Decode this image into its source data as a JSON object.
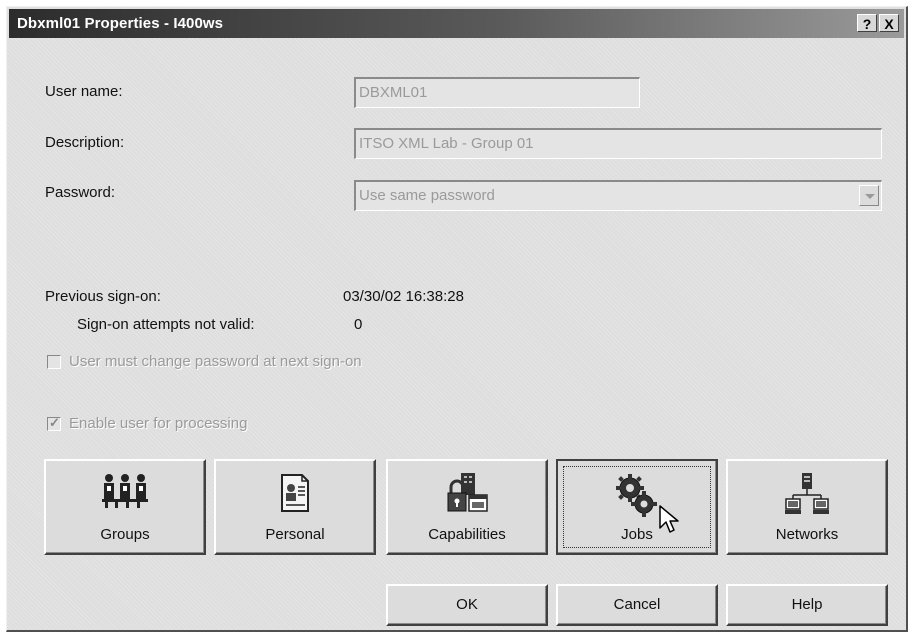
{
  "window": {
    "title": "Dbxml01 Properties - I400ws",
    "help_glyph": "?",
    "close_glyph": "X"
  },
  "form": {
    "user_name_label": "User name:",
    "user_name_value": "DBXML01",
    "description_label": "Description:",
    "description_value": "ITSO XML Lab - Group 01",
    "password_label": "Password:",
    "password_value": "Use same password"
  },
  "signon": {
    "previous_label": "Previous sign-on:",
    "previous_value": "03/30/02 16:38:28",
    "attempts_label": "Sign-on attempts not valid:",
    "attempts_value": "0"
  },
  "checkboxes": {
    "change_password_label": "User must change password at next sign-on",
    "change_password_checked": false,
    "enable_user_label": "Enable user for processing",
    "enable_user_checked": true
  },
  "category_buttons": [
    {
      "label": "Groups",
      "icon": "groups-icon"
    },
    {
      "label": "Personal",
      "icon": "personal-icon"
    },
    {
      "label": "Capabilities",
      "icon": "capabilities-icon"
    },
    {
      "label": "Jobs",
      "icon": "jobs-icon"
    },
    {
      "label": "Networks",
      "icon": "networks-icon"
    }
  ],
  "dialog_buttons": {
    "ok": "OK",
    "cancel": "Cancel",
    "help": "Help"
  }
}
